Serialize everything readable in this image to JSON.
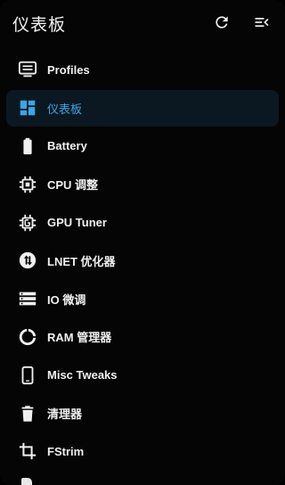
{
  "header": {
    "title": "仪表板",
    "refresh_icon": "refresh-icon",
    "collapse_icon": "menu-collapse-icon"
  },
  "colors": {
    "background": "#000000",
    "accent": "#3aa6e6",
    "active_bg": "#0b1822",
    "text": "#f0f0f0"
  },
  "menu": {
    "items": [
      {
        "label": "Profiles",
        "icon": "monitor-list-icon",
        "active": false
      },
      {
        "label": "仪表板",
        "icon": "dashboard-icon",
        "active": true
      },
      {
        "label": "Battery",
        "icon": "battery-icon",
        "active": false
      },
      {
        "label": "CPU 调整",
        "icon": "cpu-chip-icon",
        "active": false
      },
      {
        "label": "GPU Tuner",
        "icon": "gpu-chip-icon",
        "active": false
      },
      {
        "label": "LNET 优化器",
        "icon": "network-transfer-icon",
        "active": false
      },
      {
        "label": "IO 微调",
        "icon": "storage-stack-icon",
        "active": false
      },
      {
        "label": "RAM 管理器",
        "icon": "memory-ring-icon",
        "active": false
      },
      {
        "label": "Misc Tweaks",
        "icon": "phone-icon",
        "active": false
      },
      {
        "label": "清理器",
        "icon": "trash-icon",
        "active": false
      },
      {
        "label": "FStrim",
        "icon": "crop-icon",
        "active": false
      }
    ]
  }
}
